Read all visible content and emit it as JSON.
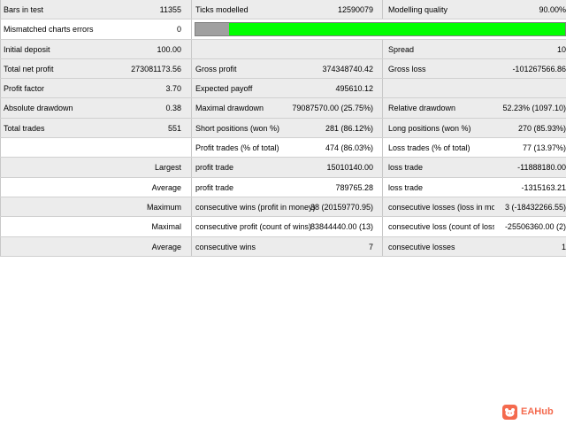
{
  "rows": [
    {
      "c1": "Bars in test",
      "v1": "11355",
      "c2": "Ticks modelled",
      "v2": "12590079",
      "c3": "Modelling quality",
      "v3": "90.00%"
    },
    {
      "c1": "Mismatched charts errors",
      "v1": "0",
      "quality": 0.09
    },
    {
      "c1": "Initial deposit",
      "v1": "100.00",
      "c3": "Spread",
      "v3": "10"
    },
    {
      "c1": "Total net profit",
      "v1": "273081173.56",
      "c2": "Gross profit",
      "v2": "374348740.42",
      "c3": "Gross loss",
      "v3": "-101267566.86"
    },
    {
      "c1": "Profit factor",
      "v1": "3.70",
      "c2": "Expected payoff",
      "v2": "495610.12"
    },
    {
      "c1": "Absolute drawdown",
      "v1": "0.38",
      "c2": "Maximal drawdown",
      "v2": "79087570.00 (25.75%)",
      "c3": "Relative drawdown",
      "v3": "52.23% (1097.10)"
    },
    {
      "c1": "Total trades",
      "v1": "551",
      "c2": "Short positions (won %)",
      "v2": "281 (86.12%)",
      "c3": "Long positions (won %)",
      "v3": "270 (85.93%)"
    },
    {
      "r1": "",
      "c2": "Profit trades (% of total)",
      "v2": "474 (86.03%)",
      "c3": "Loss trades (% of total)",
      "v3": "77 (13.97%)"
    },
    {
      "r1": "Largest",
      "c2": "profit trade",
      "v2": "15010140.00",
      "c3": "loss trade",
      "v3": "-11888180.00"
    },
    {
      "r1": "Average",
      "c2": "profit trade",
      "v2": "789765.28",
      "c3": "loss trade",
      "v3": "-1315163.21"
    },
    {
      "r1": "Maximum",
      "c2": "consecutive wins (profit in money)",
      "v2": "38 (20159770.95)",
      "c3": "consecutive losses (loss in money)",
      "v3": "3 (-18432266.55)"
    },
    {
      "r1": "Maximal",
      "c2": "consecutive profit (count of wins)",
      "v2": "83844440.00 (13)",
      "c3": "consecutive loss (count of losses)",
      "v3": "-25506360.00 (2)"
    },
    {
      "r1": "Average",
      "c2": "consecutive wins",
      "v2": "7",
      "c3": "consecutive losses",
      "v3": "1"
    }
  ],
  "watermark": {
    "text": "EAHub",
    "icon": "hub-logo-icon",
    "color": "#f46a4e"
  },
  "colors": {
    "quality_good": "#00ff00",
    "quality_bad": "#a0a0a0",
    "row_shade": "#ececec"
  }
}
